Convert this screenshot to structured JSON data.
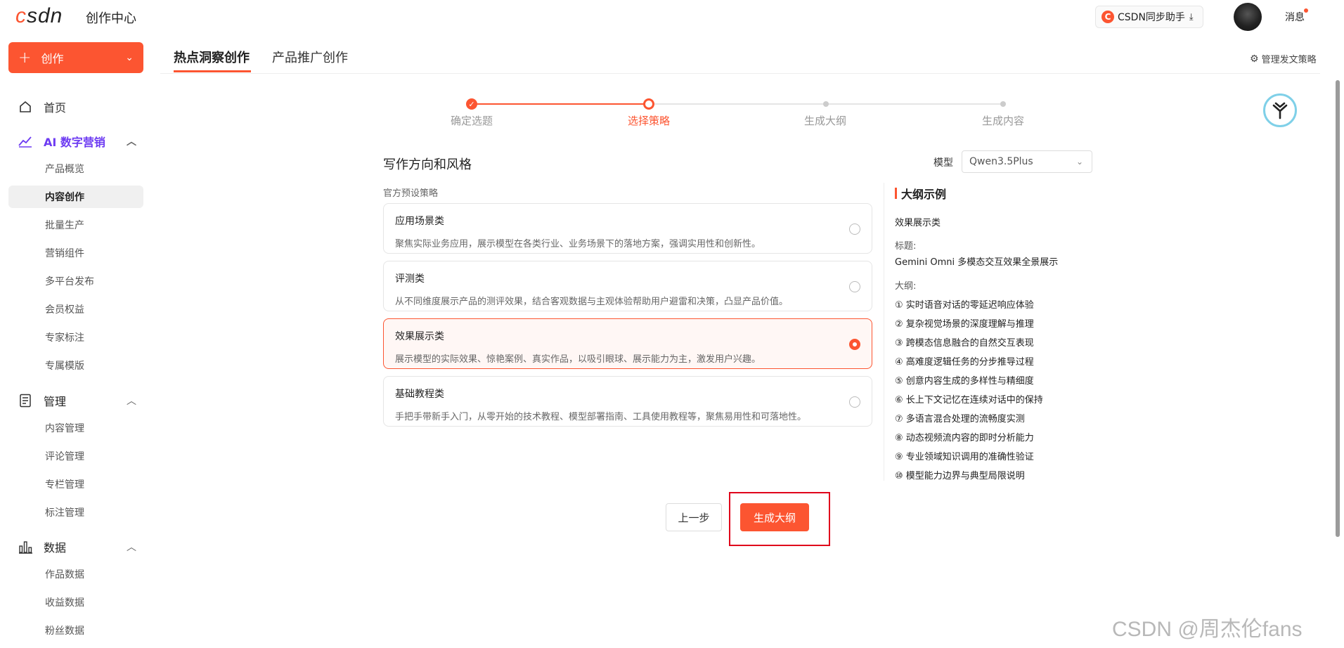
{
  "header": {
    "logo": "csdn",
    "title": "创作中心",
    "sync_label": "CSDN同步助手",
    "messages_label": "消息"
  },
  "sidebar": {
    "create_label": "创作",
    "home_label": "首页",
    "sections": [
      {
        "title": "AI 数字营销",
        "items": [
          "产品概览",
          "内容创作",
          "批量生产",
          "营销组件",
          "多平台发布",
          "会员权益",
          "专家标注",
          "专属模版"
        ]
      },
      {
        "title": "管理",
        "items": [
          "内容管理",
          "评论管理",
          "专栏管理",
          "标注管理"
        ]
      },
      {
        "title": "数据",
        "items": [
          "作品数据",
          "收益数据",
          "粉丝数据"
        ]
      }
    ],
    "active_item": "内容创作"
  },
  "tabs": [
    {
      "label": "热点洞察创作",
      "active": true
    },
    {
      "label": "产品推广创作",
      "active": false
    }
  ],
  "strategy_link": "管理发文策略",
  "steps": [
    {
      "label": "确定选题",
      "state": "done"
    },
    {
      "label": "选择策略",
      "state": "current"
    },
    {
      "label": "生成大纲",
      "state": "pending"
    },
    {
      "label": "生成内容",
      "state": "pending"
    }
  ],
  "content": {
    "section_title": "写作方向和风格",
    "model_label": "模型",
    "model_value": "Qwen3.5Plus",
    "preset_label": "官方预设策略",
    "cards": [
      {
        "title": "应用场景类",
        "desc": "聚焦实际业务应用，展示模型在各类行业、业务场景下的落地方案，强调实用性和创新性。",
        "selected": false
      },
      {
        "title": "评测类",
        "desc": "从不同维度展示产品的测评效果，结合客观数据与主观体验帮助用户避雷和决策，凸显产品价值。",
        "selected": false
      },
      {
        "title": "效果展示类",
        "desc": "展示模型的实际效果、惊艳案例、真实作品，以吸引眼球、展示能力为主，激发用户兴趣。",
        "selected": true
      },
      {
        "title": "基础教程类",
        "desc": "手把手带新手入门，从零开始的技术教程、模型部署指南、工具使用教程等，聚焦易用性和可落地性。",
        "selected": false
      }
    ]
  },
  "outline": {
    "heading": "大纲示例",
    "category": "效果展示类",
    "title_label": "标题:",
    "title_value": "Gemini Omni 多模态交互效果全景展示",
    "outline_label": "大纲:",
    "items": [
      "① 实时语音对话的零延迟响应体验",
      "② 复杂视觉场景的深度理解与推理",
      "③ 跨模态信息融合的自然交互表现",
      "④ 高难度逻辑任务的分步推导过程",
      "⑤ 创意内容生成的多样性与精细度",
      "⑥ 长上下文记忆在连续对话中的保持",
      "⑦ 多语言混合处理的流畅度实测",
      "⑧ 动态视频流内容的即时分析能力",
      "⑨ 专业领域知识调用的准确性验证",
      "⑩ 模型能力边界与典型局限说明"
    ]
  },
  "buttons": {
    "prev": "上一步",
    "generate": "生成大纲"
  },
  "watermark": "CSDN @周杰伦fans",
  "colors": {
    "brand": "#fc5531",
    "ai_accent": "#6d3bf2",
    "highlight_box": "#e0001b"
  }
}
